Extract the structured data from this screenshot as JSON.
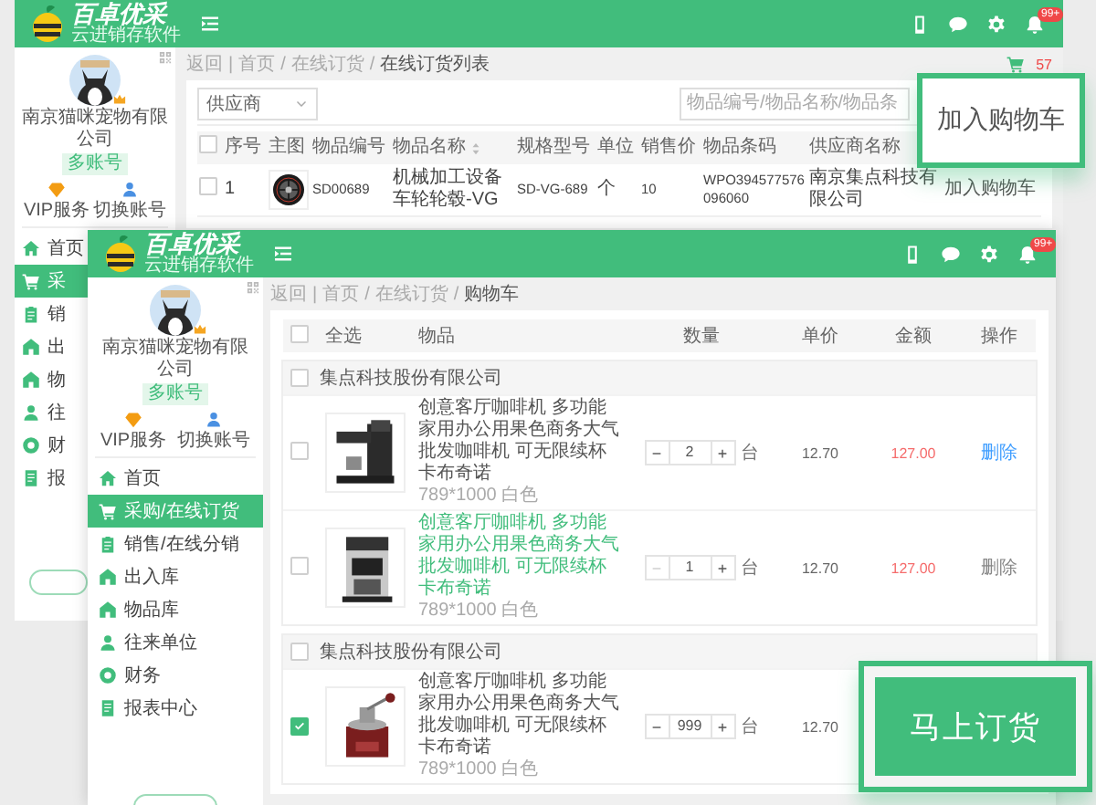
{
  "windows": [
    {
      "kind": "order_list",
      "header": {
        "logo": "百卓优采",
        "tagline": "云进销存软件",
        "notification_badge": "99+"
      },
      "sidebar": {
        "company": "南京猫咪宠物有限公司",
        "account_badge": "多账号",
        "actions": [
          {
            "label": "VIP服务"
          },
          {
            "label": "切换账号"
          }
        ],
        "menu": [
          {
            "label": "首页",
            "selected": false
          },
          {
            "label": "采",
            "selected": true
          },
          {
            "label": "销",
            "selected": false
          },
          {
            "label": "出",
            "selected": false
          },
          {
            "label": "物",
            "selected": false
          },
          {
            "label": "往",
            "selected": false
          },
          {
            "label": "财",
            "selected": false
          },
          {
            "label": "报",
            "selected": false
          }
        ],
        "footer_button": true
      },
      "breadcrumb": {
        "back": "返回",
        "separator": "|",
        "path_separator": "/",
        "path": [
          {
            "label": "首页",
            "current": false
          },
          {
            "label": "在线订货",
            "current": false
          },
          {
            "label": "在线订货列表",
            "current": true
          }
        ]
      },
      "cart_count": "57",
      "supplier_filter": {
        "placeholder": "供应商"
      },
      "search": {
        "placeholder": "物品编号/物品名称/物品条"
      },
      "table": {
        "select_all_checked": false,
        "columns": [
          {
            "label": "序号",
            "sortable": false
          },
          {
            "label": "主图",
            "sortable": false
          },
          {
            "label": "物品编号",
            "sortable": false
          },
          {
            "label": "物品名称",
            "sortable": true
          },
          {
            "label": "规格型号",
            "sortable": false
          },
          {
            "label": "单位",
            "sortable": false
          },
          {
            "label": "销售价",
            "sortable": false
          },
          {
            "label": "物品条码",
            "sortable": false
          },
          {
            "label": "供应商名称",
            "sortable": false
          }
        ],
        "rows": [
          {
            "checked": false,
            "number": "1",
            "code": "SD00689",
            "name": "机械加工设备车轮轮毂-VG",
            "model": "SD-VG-689",
            "unit": "个",
            "price": "10",
            "barcode": "WPO394577576096060",
            "supplier": "南京集点科技有限公司",
            "action": "加入购物车"
          }
        ]
      }
    },
    {
      "kind": "cart",
      "header": {
        "logo": "百卓优采",
        "tagline": "云进销存软件",
        "notification_badge": "99+"
      },
      "sidebar": {
        "company": "南京猫咪宠物有限公司",
        "account_badge": "多账号",
        "actions": [
          {
            "label": "VIP服务"
          },
          {
            "label": "切换账号"
          }
        ],
        "menu": [
          {
            "label": "首页",
            "selected": false
          },
          {
            "label": "采购/在线订货",
            "selected": true
          },
          {
            "label": "销售/在线分销",
            "selected": false
          },
          {
            "label": "出入库",
            "selected": false
          },
          {
            "label": "物品库",
            "selected": false
          },
          {
            "label": "往来单位",
            "selected": false
          },
          {
            "label": "财务",
            "selected": false
          },
          {
            "label": "报表中心",
            "selected": false
          }
        ],
        "footer_button": true
      },
      "breadcrumb": {
        "back": "返回",
        "separator": "|",
        "path_separator": "/",
        "path": [
          {
            "label": "首页",
            "current": false
          },
          {
            "label": "在线订货",
            "current": false
          },
          {
            "label": "购物车",
            "current": true
          }
        ]
      },
      "select_all_checked": false,
      "columns": [
        "全选",
        "物品",
        "数量",
        "单价",
        "金额",
        "操作"
      ],
      "groups": [
        {
          "supplier": "集点科技股份有限公司",
          "checked": false,
          "items": [
            {
              "checked": false,
              "name": "创意客厅咖啡机 多功能家用办公用果色商务大气批发咖啡机 可无限续杯卡布奇诺",
              "name_highlighted": false,
              "spec": "789*1000 白色",
              "quantity": "2",
              "minus_disabled": false,
              "unit": "台",
              "unit_price": "12.70",
              "amount": "127.00",
              "action": "删除",
              "action_highlighted": true
            },
            {
              "checked": false,
              "name": "创意客厅咖啡机 多功能家用办公用果色商务大气批发咖啡机 可无限续杯卡布奇诺",
              "name_highlighted": true,
              "spec": "789*1000 白色",
              "quantity": "1",
              "minus_disabled": true,
              "unit": "台",
              "unit_price": "12.70",
              "amount": "127.00",
              "action": "删除",
              "action_highlighted": false
            }
          ]
        },
        {
          "supplier": "集点科技股份有限公司",
          "checked": false,
          "items": [
            {
              "checked": true,
              "name": "创意客厅咖啡机 多功能家用办公用果色商务大气批发咖啡机 可无限续杯卡布奇诺",
              "name_highlighted": false,
              "spec": "789*1000 白色",
              "quantity": "999",
              "minus_disabled": false,
              "unit": "台",
              "unit_price": "12.70"
            }
          ]
        }
      ]
    }
  ],
  "callouts": [
    {
      "kind": "label",
      "text": "加入购物车"
    },
    {
      "kind": "button",
      "text": "马上订货"
    }
  ]
}
